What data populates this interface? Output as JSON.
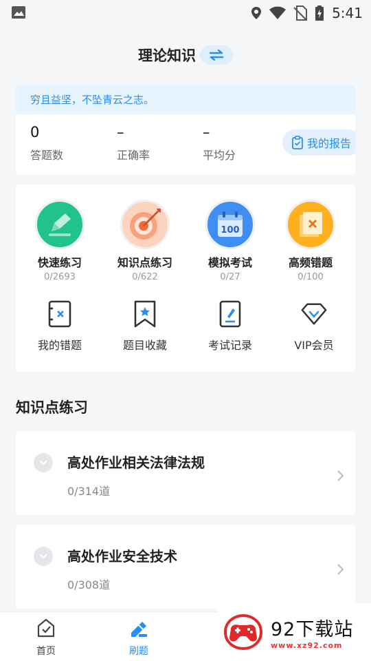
{
  "status_bar": {
    "time": "5:41"
  },
  "header": {
    "title": "理论知识"
  },
  "summary": {
    "motto": "穷且益坚，不坠青云之志。",
    "stats": [
      {
        "value": "0",
        "label": "答题数"
      },
      {
        "value": "–",
        "label": "正确率"
      },
      {
        "value": "–",
        "label": "平均分"
      }
    ],
    "report_label": "我的报告"
  },
  "practice": [
    {
      "label": "快速练习",
      "count": "0/2693"
    },
    {
      "label": "知识点练习",
      "count": "0/622"
    },
    {
      "label": "模拟考试",
      "count": "0/27"
    },
    {
      "label": "高频错题",
      "count": "0/100"
    }
  ],
  "tools": [
    {
      "label": "我的错题"
    },
    {
      "label": "题目收藏"
    },
    {
      "label": "考试记录"
    },
    {
      "label": "VIP会员"
    }
  ],
  "section_title": "知识点练习",
  "topics": [
    {
      "title": "高处作业相关法律法规",
      "count": "0/314道"
    },
    {
      "title": "高处作业安全技术",
      "count": "0/308道"
    }
  ],
  "bottom_nav": [
    {
      "label": "首页"
    },
    {
      "label": "刷题"
    }
  ],
  "watermark": {
    "text": "92下载站",
    "url": "www.xz92.com"
  },
  "colors": {
    "accent": "#2a8ef0",
    "page_bg": "#f4f6f8"
  }
}
